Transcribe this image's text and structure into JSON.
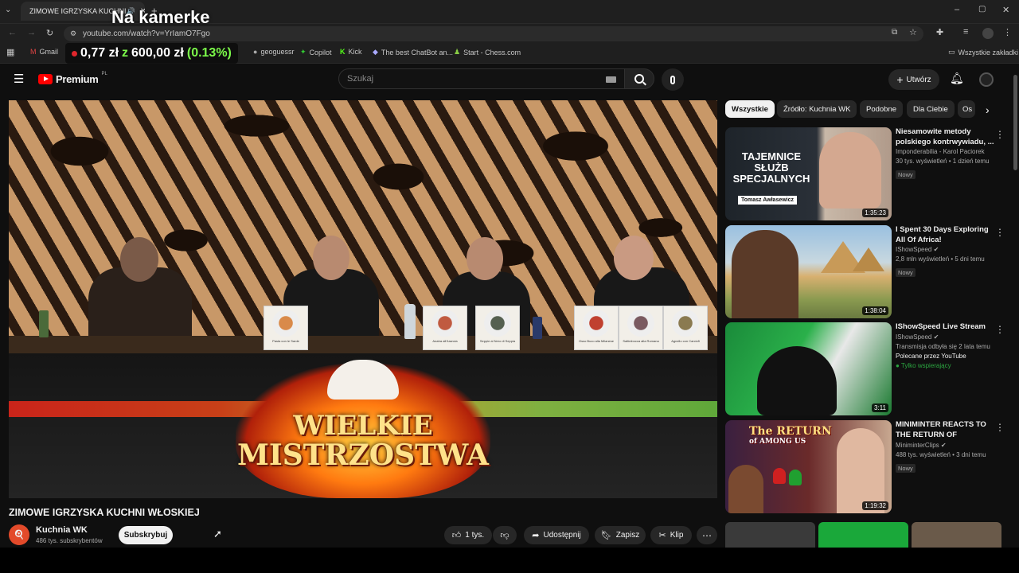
{
  "browser": {
    "tab_title": "ZIMOWE IGRZYSKA KUCHNI",
    "url": "youtube.com/watch?v=YrIamO7Fgo",
    "bookmarks": [
      {
        "label": "Gmail"
      },
      {
        "label": "geoguessr"
      },
      {
        "label": "Copilot"
      },
      {
        "label": "Kick"
      },
      {
        "label": "The best ChatBot an..."
      },
      {
        "label": "Start - Chess.com"
      }
    ],
    "all_bookmarks": "Wszystkie zakładki"
  },
  "overlay": {
    "title": "Na kamerke",
    "ticker_amount": "0,77 zł",
    "ticker_z": "z",
    "ticker_goal": "600,00 zł",
    "ticker_percent": "(0.13%)"
  },
  "header": {
    "logo_label": "Premium",
    "logo_region": "PL",
    "search_placeholder": "Szukaj",
    "create_label": "Utwórz"
  },
  "video": {
    "title": "ZIMOWE IGRZYSKA KUCHNI WŁOSKIEJ",
    "logo_line1": "WIELKIE",
    "logo_line2": "MISTRZOSTWA",
    "cards": [
      "Pasta con le Sarde",
      "Anatra all'Arancia",
      "Seppie al Nero di Seppia",
      "Osso Buco alla Milanese",
      "Saltimbocca alla Romana",
      "Agnello con Carciofi"
    ],
    "channel": "Kuchnia WK",
    "subscribers": "486 tys. subskrybentów",
    "subscribe_label": "Subskrybuj",
    "likes": "1 tys.",
    "share_label": "Udostępnij",
    "save_label": "Zapisz",
    "clip_label": "Klip"
  },
  "sidebar": {
    "chips": [
      "Wszystkie",
      "Źródło: Kuchnia WK",
      "Podobne",
      "Dla Ciebie",
      "Os"
    ],
    "videos": [
      {
        "title": "Niesamowite metody polskiego kontrwywiadu, ...",
        "channel": "Imponderabilia - Karol Paciorek",
        "stats": "30 tys. wyświetleń • 1 dzień temu",
        "badge": "Nowy",
        "duration": "1:35:23",
        "thumb_text1": "TAJEMNICE",
        "thumb_text2": "SŁUŻB",
        "thumb_text3": "SPECJALNYCH",
        "thumb_name": "Tomasz Awłasewicz"
      },
      {
        "title": "I Spent 30 Days Exploring All Of Africa!",
        "channel": "IShowSpeed",
        "stats": "2,8 mln wyświetleń • 5 dni temu",
        "badge": "Nowy",
        "duration": "1:38:04"
      },
      {
        "title": "IShowSpeed Live Stream",
        "channel": "IShowSpeed",
        "stats": "Transmisja odbyła się 2 lata temu",
        "extra": "Polecane przez YouTube",
        "members": "Tylko wspierający",
        "duration": "3:11"
      },
      {
        "title": "MINIMINTER REACTS TO THE RETURN OF SIDEMEN...",
        "channel": "MiniminterClips",
        "stats": "488 tys. wyświetleń • 3 dni temu",
        "badge": "Nowy",
        "duration": "1:19:32",
        "thumb_text1": "The RETURN",
        "thumb_text2": "of AMONG US"
      }
    ]
  },
  "colors": {
    "background": "#0f0f0f",
    "youtube_red": "#ff0000",
    "ticker_green": "#7cfc4a",
    "verified_grey": "#aaaaaa"
  }
}
